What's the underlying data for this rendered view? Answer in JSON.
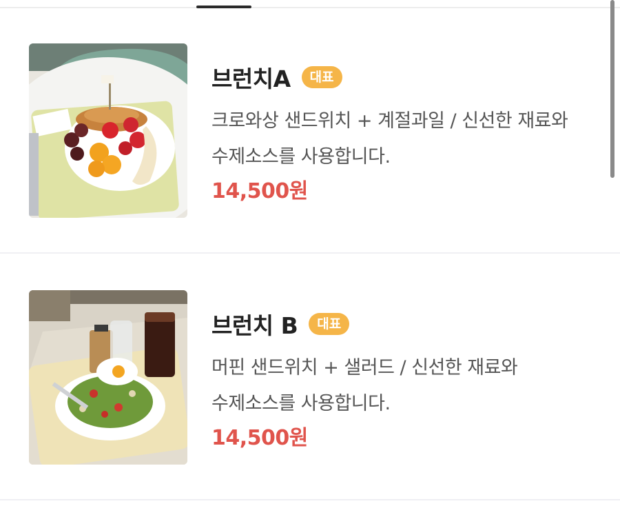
{
  "menu": {
    "items": [
      {
        "name": "브런치A",
        "badge": "대표",
        "description": "크로와상 샌드위치 + 계절과일 / 신선한 재료와 수제소스를 사용합니다.",
        "price": "14,500원",
        "photo_icon": "brunch-a-photo"
      },
      {
        "name": "브런치 B",
        "badge": "대표",
        "description": "머핀 샌드위치 + 샐러드 / 신선한 재료와 수제소스를 사용합니다.",
        "price": "14,500원",
        "photo_icon": "brunch-b-photo"
      }
    ]
  },
  "colors": {
    "badge": "#f5b548",
    "price": "#e0544c",
    "title": "#222222",
    "description": "#555555"
  }
}
